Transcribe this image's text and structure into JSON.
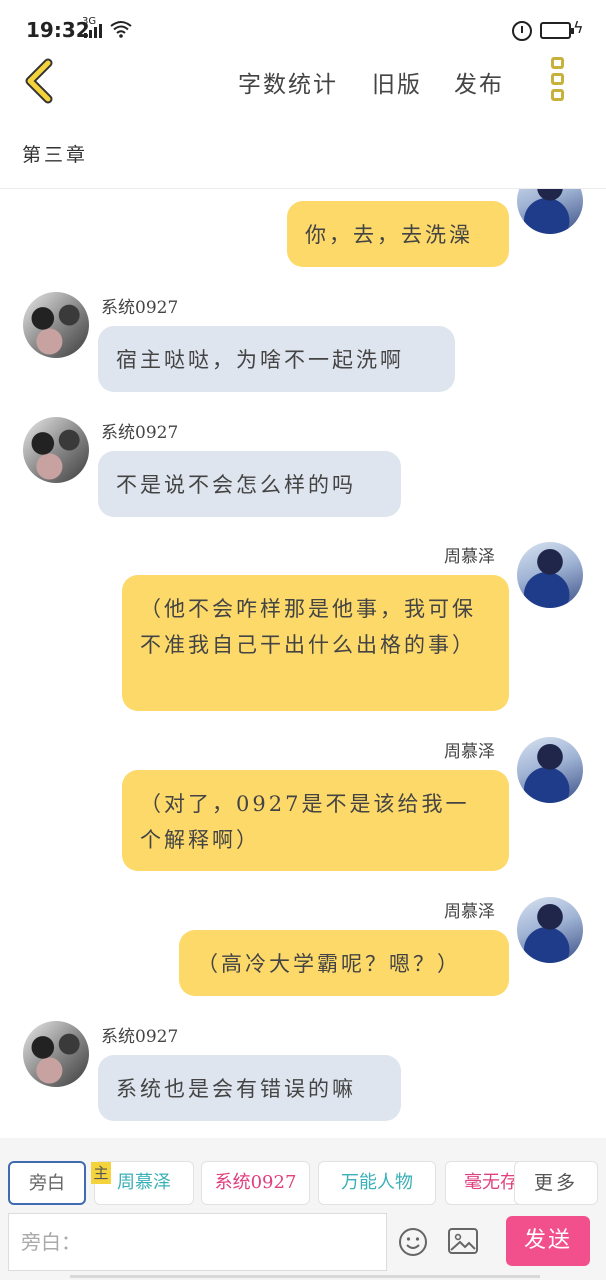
{
  "status_bar": {
    "time": "19:32",
    "network": "3G"
  },
  "toolbar": {
    "word_count_label": "字数统计",
    "old_version_label": "旧版",
    "publish_label": "发布"
  },
  "chapter": {
    "title": "第三章"
  },
  "messages": [
    {
      "side": "right",
      "sender": "",
      "text": "你，去，去洗澡",
      "avatar": "boy-avatar"
    },
    {
      "side": "left",
      "sender": "系统0927",
      "text": "宿主哒哒，为啥不一起洗啊",
      "avatar": "cat-avatar"
    },
    {
      "side": "left",
      "sender": "系统0927",
      "text": "不是说不会怎么样的吗",
      "avatar": "cat-avatar"
    },
    {
      "side": "right",
      "sender": "周慕泽",
      "text": "（他不会咋样那是他事，我可保不准我自己干出什么出格的事）",
      "avatar": "boy-avatar"
    },
    {
      "side": "right",
      "sender": "周慕泽",
      "text": "（对了，0927是不是该给我一个解释啊）",
      "avatar": "boy-avatar"
    },
    {
      "side": "right",
      "sender": "周慕泽",
      "text": "（高冷大学霸呢？嗯？）",
      "avatar": "boy-avatar"
    },
    {
      "side": "left",
      "sender": "系统0927",
      "text": "系统也是会有错误的嘛",
      "avatar": "cat-avatar"
    }
  ],
  "roles": {
    "tabs": [
      {
        "label": "旁白",
        "color": "#666666"
      },
      {
        "label": "周慕泽",
        "color": "#3ab0b8"
      },
      {
        "label": "系统0927",
        "color": "#e0407e"
      },
      {
        "label": "万能人物",
        "color": "#3ab0b8"
      },
      {
        "label": "毫无存",
        "color": "#e0407e"
      }
    ],
    "lead_badge": "主",
    "more_label": "更多"
  },
  "composer": {
    "placeholder": "旁白：",
    "value": "",
    "send_label": "发送"
  },
  "colors": {
    "accent_yellow": "#fdd96a",
    "bubble_grey": "#dfe5ee",
    "send_pink": "#f2508c",
    "menu_yellow": "#c8b13a"
  }
}
